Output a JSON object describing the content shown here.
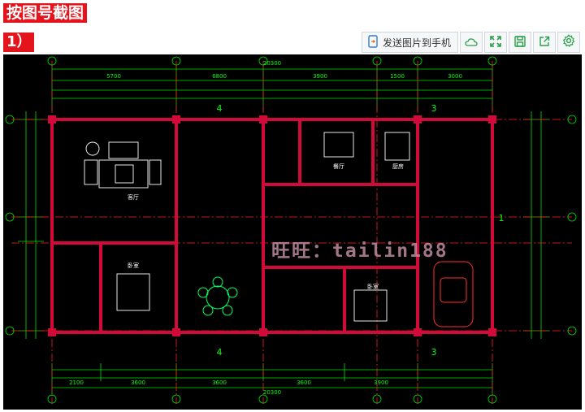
{
  "header": {
    "title": "按图号截图",
    "step_label": "1）"
  },
  "toolbar": {
    "send_label": "发送图片到手机",
    "icons": [
      "phone-send-icon",
      "cloud-icon",
      "expand-icon",
      "save-icon",
      "share-icon",
      "gear-icon"
    ]
  },
  "drawing": {
    "watermark": "旺旺：tailin188",
    "top_total_dim": "20300",
    "bottom_total_dim": "20300",
    "top_dims": [
      "5700",
      "6800",
      "3900",
      "1500",
      "3000"
    ],
    "bottom_dims": [
      "2100",
      "3600",
      "3600",
      "3600",
      "3900"
    ],
    "grid_marker": "4",
    "grid_marker_alt": "3",
    "grid_marker_side": "1",
    "room_living": "客厅",
    "room_bedroom": "卧室",
    "room_dining": "餐厅",
    "room_kitchen": "厨房"
  },
  "colors": {
    "accent_red": "#e4141c",
    "cad_background": "#000000",
    "cad_dim": "#00ff00",
    "cad_wall": "#d10a3a",
    "cad_axis": "#ff2020"
  }
}
